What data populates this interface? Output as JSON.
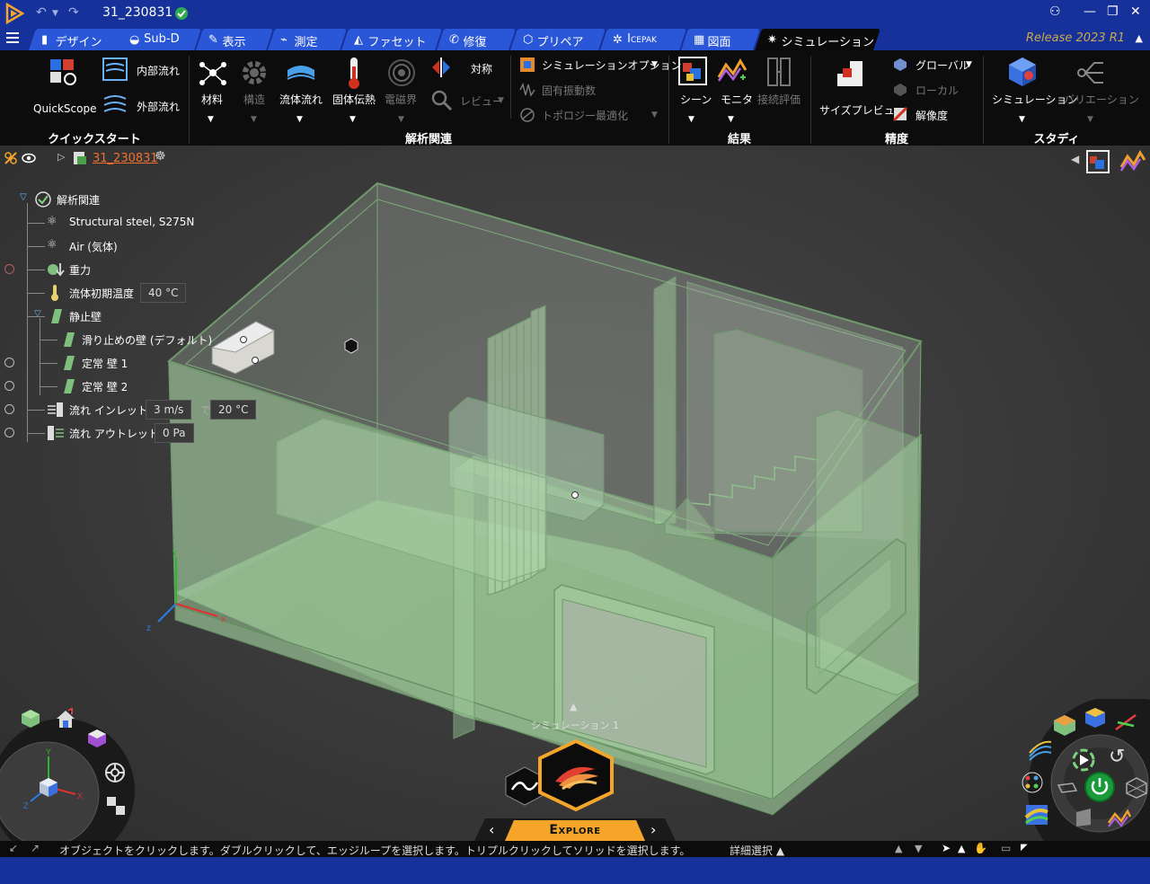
{
  "app": {
    "document_title": "31_230831",
    "release": "Release 2023 R1"
  },
  "tabs": [
    {
      "label": "デザイン",
      "active": false
    },
    {
      "label": "Sub-D",
      "active": false
    },
    {
      "label": "表示",
      "active": false
    },
    {
      "label": "測定",
      "active": false
    },
    {
      "label": "ファセット",
      "active": false
    },
    {
      "label": "修復",
      "active": false
    },
    {
      "label": "プリペア",
      "active": false
    },
    {
      "label": "Icepak",
      "active": false
    },
    {
      "label": "図面",
      "active": false
    },
    {
      "label": "シミュレーション",
      "active": true
    }
  ],
  "ribbon": {
    "quickstart": {
      "group_label": "クイックスタート",
      "quickscope": "QuickScope",
      "internal_flow": "内部流れ",
      "external_flow": "外部流れ"
    },
    "analysis": {
      "group_label": "解析関連",
      "material": "材料",
      "structure": "構造",
      "fluid_flow": "流体流れ",
      "solid_heat": "固体伝熱",
      "electromagnetic": "電磁界",
      "symmetry": "対称",
      "review": "レビュー",
      "sim_options": "シミュレーションオプション",
      "modal": "固有振動数",
      "topology": "トポロジー最適化"
    },
    "results": {
      "group_label": "結果",
      "scene": "シーン",
      "monitor": "モニタ",
      "contact_eval": "接続評価"
    },
    "accuracy": {
      "group_label": "精度",
      "size_preview": "サイズプレビュー",
      "global": "グローバル",
      "local": "ローカル",
      "resolution": "解像度"
    },
    "study": {
      "group_label": "スタディ",
      "simulation": "シミュレーション",
      "variation": "バリエーション"
    }
  },
  "viewport_header": {
    "document_link": "31_230831"
  },
  "tree": {
    "root": "解析関連",
    "material_1": "Structural steel, S275N",
    "material_2": "Air (気体)",
    "gravity": "重力",
    "initial_temp_label": "流体初期温度",
    "initial_temp_value": "40 °C",
    "static_wall": "静止壁",
    "wall_default": "滑り止めの壁 (デフォルト)",
    "wall_1": "定常 壁 1",
    "wall_2": "定常 壁 2",
    "inlet_label": "流れ インレット 1",
    "inlet_velocity": "3 m/s",
    "inlet_at": "で",
    "inlet_temp": "20 °C",
    "outlet_label": "流れ アウトレット 2",
    "outlet_pressure": "0 Pa"
  },
  "scene": {
    "simulation_label": "シミュレーション 1",
    "explore_label": "Explore",
    "axis_x": "x",
    "axis_y": "y",
    "axis_z": "z",
    "triad_x": "X",
    "triad_y": "Y",
    "triad_z": "Z"
  },
  "status": {
    "message": "オブジェクトをクリックします。ダブルクリックして、エッジループを選択します。トリプルクリックしてソリッドを選択します。",
    "detail_select": "詳細選択 ▲"
  },
  "colors": {
    "title_bar": "#16329a",
    "tab": "#2a56d8",
    "accent_orange": "#f5a52a",
    "model_green": "#9ec99a",
    "release_gold": "#c9a84b"
  }
}
